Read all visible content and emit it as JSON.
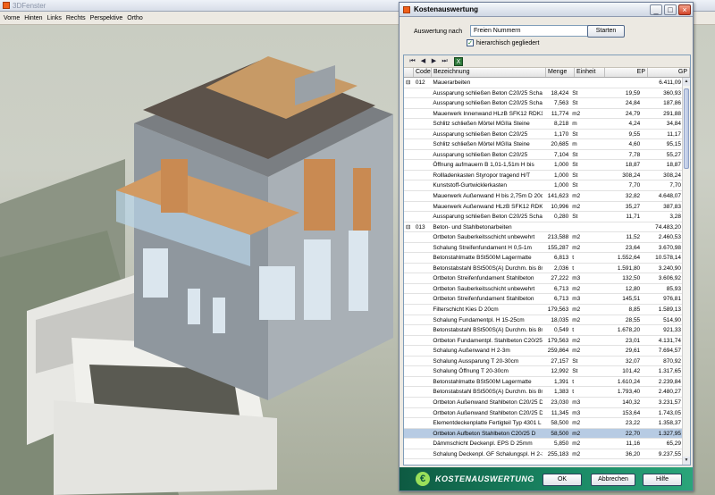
{
  "window3d": {
    "title": "3DFenster",
    "menu": [
      "Vorne",
      "Hinten",
      "Links",
      "Rechts",
      "Perspektive",
      "Ortho"
    ]
  },
  "dialog": {
    "title": "Kostenauswertung",
    "auswertung_label": "Auswertung nach",
    "auswertung_value": "Freien Nummern",
    "start_label": "Starten",
    "checkbox_label": "hierarchisch gegliedert",
    "columns": [
      "Code",
      "Bezeichnung",
      "Menge",
      "Einheit",
      "EP",
      "GP"
    ],
    "rows": [
      {
        "code": "012",
        "name": "Mauerarbeiten",
        "qty": "",
        "unit": "",
        "ep": "",
        "gp": "6.411,09",
        "group": true
      },
      {
        "code": "",
        "name": "Aussparung schließen Beton C20/25 Schalung",
        "qty": "18,424",
        "unit": "St",
        "ep": "19,59",
        "gp": "360,93"
      },
      {
        "code": "",
        "name": "Aussparung schließen Beton C20/25 Schalung",
        "qty": "7,563",
        "unit": "St",
        "ep": "24,84",
        "gp": "187,86"
      },
      {
        "code": "",
        "name": "Mauerwerk Innenwand HLzB SFK12 RDK1,6 D",
        "qty": "11,774",
        "unit": "m2",
        "ep": "24,79",
        "gp": "291,88"
      },
      {
        "code": "",
        "name": "Schlitz schließen Mörtel MGIIa Steine",
        "qty": "8,218",
        "unit": "m",
        "ep": "4,24",
        "gp": "34,84"
      },
      {
        "code": "",
        "name": "Aussparung schließen Beton C20/25",
        "qty": "1,170",
        "unit": "St",
        "ep": "9,55",
        "gp": "11,17"
      },
      {
        "code": "",
        "name": "Schlitz schließen Mörtel MGIIa Steine",
        "qty": "20,685",
        "unit": "m",
        "ep": "4,60",
        "gp": "95,15"
      },
      {
        "code": "",
        "name": "Aussparung schließen Beton C20/25",
        "qty": "7,104",
        "unit": "St",
        "ep": "7,78",
        "gp": "55,27"
      },
      {
        "code": "",
        "name": "Öffnung aufmauern B 1,01-1,51m H bis",
        "qty": "1,000",
        "unit": "St",
        "ep": "18,87",
        "gp": "18,87"
      },
      {
        "code": "",
        "name": "Rollladenkasten Styropor tragend H/T",
        "qty": "1,000",
        "unit": "St",
        "ep": "308,24",
        "gp": "308,24"
      },
      {
        "code": "",
        "name": "Kunststoff-Gurtwicklerkasten",
        "qty": "1,000",
        "unit": "St",
        "ep": "7,70",
        "gp": "7,70"
      },
      {
        "code": "",
        "name": "Mauerwerk Außenwand H bis 2,75m D 20cm",
        "qty": "141,623",
        "unit": "m2",
        "ep": "32,82",
        "gp": "4.648,07"
      },
      {
        "code": "",
        "name": "Mauerwerk Außenwand HLzB SFK12 RDK1,6",
        "qty": "10,996",
        "unit": "m2",
        "ep": "35,27",
        "gp": "387,83"
      },
      {
        "code": "",
        "name": "Aussparung schließen Beton C20/25 Schalung",
        "qty": "0,280",
        "unit": "St",
        "ep": "11,71",
        "gp": "3,28"
      },
      {
        "code": "013",
        "name": "Beton- und Stahlbetonarbeiten",
        "qty": "",
        "unit": "",
        "ep": "",
        "gp": "74.483,20",
        "group": true
      },
      {
        "code": "",
        "name": "Ortbeton Sauberkeitsschicht unbewehrt",
        "qty": "213,588",
        "unit": "m2",
        "ep": "11,52",
        "gp": "2.460,53"
      },
      {
        "code": "",
        "name": "Schalung Streifenfundament H 0,5-1m",
        "qty": "155,287",
        "unit": "m2",
        "ep": "23,64",
        "gp": "3.670,98"
      },
      {
        "code": "",
        "name": "Betonstahlmatte BSt500M Lagermatte",
        "qty": "6,813",
        "unit": "t",
        "ep": "1.552,64",
        "gp": "10.578,14"
      },
      {
        "code": "",
        "name": "Betonstabstahl BSt500S(A) Durchm. bis 8mm",
        "qty": "2,036",
        "unit": "t",
        "ep": "1.591,80",
        "gp": "3.240,90"
      },
      {
        "code": "",
        "name": "Ortbeton Streifenfundament Stahlbeton",
        "qty": "27,222",
        "unit": "m3",
        "ep": "132,50",
        "gp": "3.606,92"
      },
      {
        "code": "",
        "name": "Ortbeton Sauberkeitsschicht unbewehrt",
        "qty": "6,713",
        "unit": "m2",
        "ep": "12,80",
        "gp": "85,93"
      },
      {
        "code": "",
        "name": "Ortbeton Streifenfundament Stahlbeton",
        "qty": "6,713",
        "unit": "m3",
        "ep": "145,51",
        "gp": "976,81"
      },
      {
        "code": "",
        "name": "Filterschicht Kies D 20cm",
        "qty": "179,563",
        "unit": "m2",
        "ep": "8,85",
        "gp": "1.589,13"
      },
      {
        "code": "",
        "name": "Schalung Fundamentpl. H 15-25cm",
        "qty": "18,035",
        "unit": "m2",
        "ep": "28,55",
        "gp": "514,90"
      },
      {
        "code": "",
        "name": "Betonstabstahl BSt500S(A) Durchm. bis 8mm",
        "qty": "0,549",
        "unit": "t",
        "ep": "1.678,20",
        "gp": "921,33"
      },
      {
        "code": "",
        "name": "Ortbeton Fundamentpl. Stahlbeton C20/25 D",
        "qty": "179,563",
        "unit": "m2",
        "ep": "23,01",
        "gp": "4.131,74"
      },
      {
        "code": "",
        "name": "Schalung Außenwand H 2-3m",
        "qty": "259,864",
        "unit": "m2",
        "ep": "29,61",
        "gp": "7.694,57"
      },
      {
        "code": "",
        "name": "Schalung Aussparung T 20-30cm",
        "qty": "27,157",
        "unit": "St",
        "ep": "32,07",
        "gp": "870,92"
      },
      {
        "code": "",
        "name": "Schalung Öffnung T 20-30cm",
        "qty": "12,992",
        "unit": "St",
        "ep": "101,42",
        "gp": "1.317,65"
      },
      {
        "code": "",
        "name": "Betonstahlmatte BSt500M Lagermatte",
        "qty": "1,391",
        "unit": "t",
        "ep": "1.610,24",
        "gp": "2.239,84"
      },
      {
        "code": "",
        "name": "Betonstabstahl BSt500S(A) Durchm. bis 8mm",
        "qty": "1,383",
        "unit": "t",
        "ep": "1.793,40",
        "gp": "2.480,27"
      },
      {
        "code": "",
        "name": "Ortbeton Außenwand Stahlbeton C20/25 D",
        "qty": "23,030",
        "unit": "m3",
        "ep": "140,32",
        "gp": "3.231,57"
      },
      {
        "code": "",
        "name": "Ortbeton Außenwand Stahlbeton C20/25 D",
        "qty": "11,345",
        "unit": "m3",
        "ep": "153,64",
        "gp": "1.743,05"
      },
      {
        "code": "",
        "name": "Elementdeckenplatte Fertigteil Typ 4301 L",
        "qty": "58,500",
        "unit": "m2",
        "ep": "23,22",
        "gp": "1.358,37"
      },
      {
        "code": "",
        "name": "Ortbeton Aufbeton Stahlbeton C20/25 D",
        "qty": "58,500",
        "unit": "m2",
        "ep": "22,70",
        "gp": "1.327,95",
        "selected": true
      },
      {
        "code": "",
        "name": "Dämmschicht Deckenpl. EPS D 25mm",
        "qty": "5,850",
        "unit": "m2",
        "ep": "11,16",
        "gp": "65,29"
      },
      {
        "code": "",
        "name": "Schalung Deckenpl. GF Schalungspl. H 2-3m",
        "qty": "255,183",
        "unit": "m2",
        "ep": "36,20",
        "gp": "9.237,55"
      }
    ],
    "footer_title": "KOSTENAUSWERTUNG",
    "ok_label": "OK",
    "cancel_label": "Abbrechen",
    "help_label": "Hilfe"
  }
}
